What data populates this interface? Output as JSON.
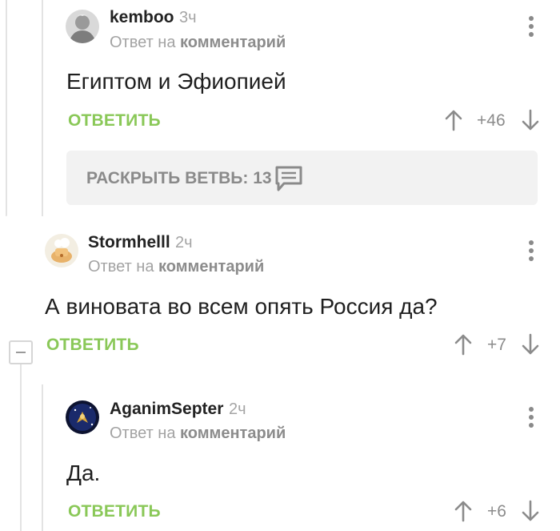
{
  "comments": [
    {
      "username": "kemboo",
      "time": "3ч",
      "reply_prefix": "Ответ на",
      "reply_target": "комментарий",
      "text": "Египтом и Эфиопией",
      "reply_label": "ОТВЕТИТЬ",
      "rating": "+46",
      "expand_label": "РАСКРЫТЬ ВЕТВЬ: 13"
    },
    {
      "username": "Stormhelll",
      "time": "2ч",
      "reply_prefix": "Ответ на",
      "reply_target": "комментарий",
      "text": "А виновата во всем опять Россия да?",
      "reply_label": "ОТВЕТИТЬ",
      "rating": "+7"
    },
    {
      "username": "AganimSepter",
      "time": "2ч",
      "reply_prefix": "Ответ на",
      "reply_target": "комментарий",
      "text": "Да.",
      "reply_label": "ОТВЕТИТЬ",
      "rating": "+6"
    }
  ],
  "colors": {
    "accent_green": "#8ac858",
    "muted_gray": "#8b8b8b",
    "branch_bg": "#f2f2f2"
  },
  "icons": {
    "upvote": "arrow-up-icon",
    "downvote": "arrow-down-icon",
    "menu": "kebab-menu-icon",
    "branch": "comment-bubble-icon",
    "collapse": "minus-box-icon"
  }
}
